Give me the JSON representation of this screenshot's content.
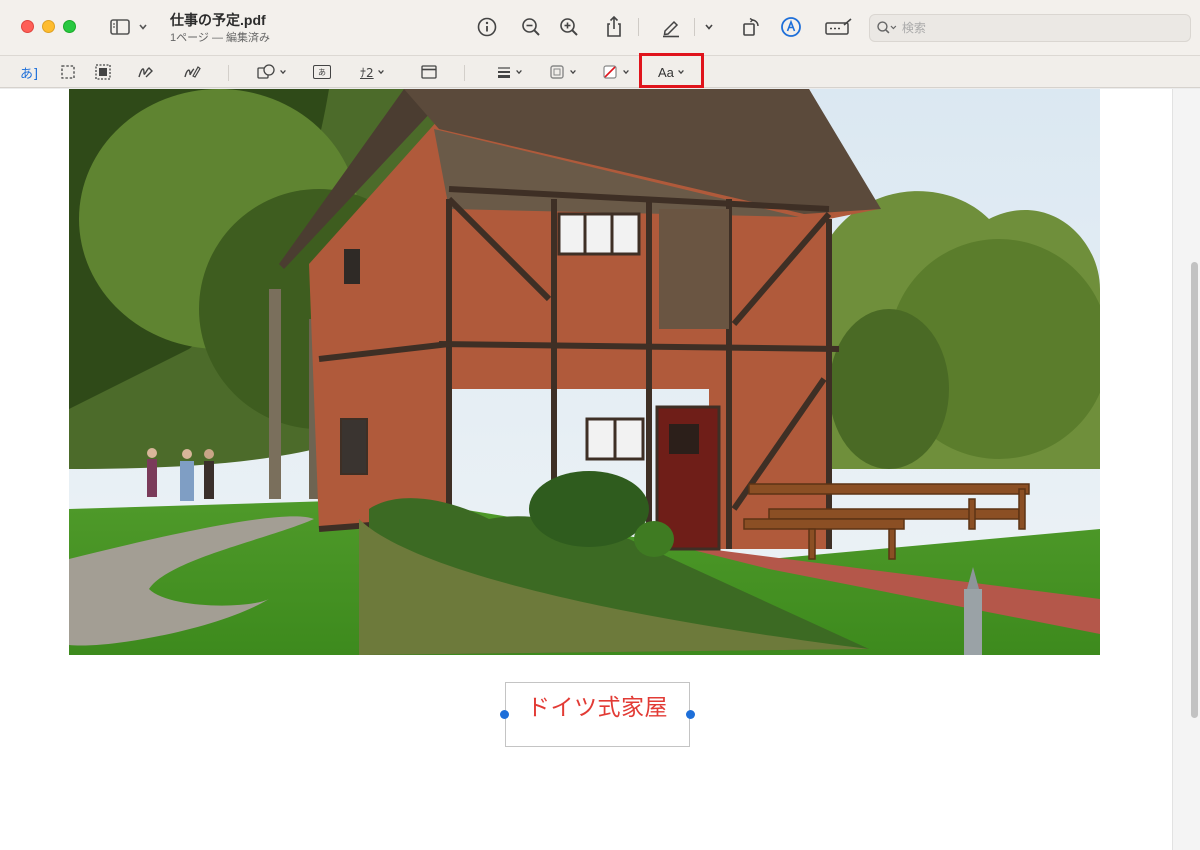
{
  "window": {
    "title": "仕事の予定.pdf",
    "subtitle": "1ページ — 編集済み"
  },
  "toolbar": {
    "icons": [
      "sidebar-icon",
      "info-icon",
      "zoom-out-icon",
      "zoom-in-icon",
      "share-icon",
      "highlight-pen-icon",
      "rotate-icon",
      "markup-icon",
      "form-fill-icon",
      "search-icon"
    ],
    "search_placeholder": "検索"
  },
  "markup_toolbar": {
    "text_selection_label": "あ]",
    "shape_style_glyph": "あ",
    "sign_glyph": "ﾅ2",
    "font_button_label": "Aa",
    "highlighted_tool": "font-button"
  },
  "document": {
    "photo_subject": "half-timbered brick house with benches and garden",
    "text_annotation": "ドイツ式家屋",
    "text_annotation_color": "#e23b35"
  },
  "colors": {
    "accent": "#1e6fd9",
    "highlight_border": "#e0141c"
  }
}
